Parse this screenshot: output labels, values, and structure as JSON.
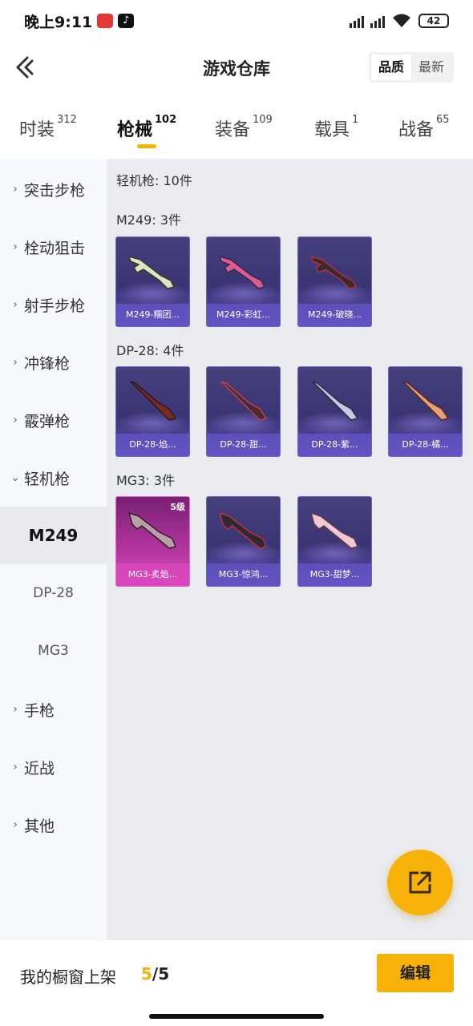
{
  "status": {
    "time": "晚上9:11",
    "battery": "42"
  },
  "header": {
    "title": "游戏仓库",
    "sort_quality": "品质",
    "sort_latest": "最新"
  },
  "tabs": [
    {
      "label": "时装",
      "count": "312"
    },
    {
      "label": "枪械",
      "count": "102"
    },
    {
      "label": "装备",
      "count": "109"
    },
    {
      "label": "载具",
      "count": "1"
    },
    {
      "label": "战备",
      "count": "65"
    }
  ],
  "sidebar": {
    "items": [
      "突击步枪",
      "栓动狙击",
      "射手步枪",
      "冲锋枪",
      "霰弹枪",
      "轻机枪"
    ],
    "subitems": [
      "M249",
      "DP-28",
      "MG3"
    ],
    "after": [
      "手枪",
      "近战",
      "其他"
    ]
  },
  "content": {
    "summary": "轻机枪: 10件",
    "groups": [
      {
        "title": "M249: 3件",
        "items": [
          "M249-糯团...",
          "M249-彩虹...",
          "M249-破晓..."
        ]
      },
      {
        "title": "DP-28: 4件",
        "items": [
          "DP-28-焰...",
          "DP-28-甜...",
          "DP-28-紫...",
          "DP-28-橘..."
        ]
      },
      {
        "title": "MG3: 3件",
        "items": [
          "MG3-炙焰...",
          "MG3-惊鸿...",
          "MG3-甜梦..."
        ],
        "level": "5级"
      }
    ]
  },
  "bottom": {
    "label": "我的橱窗上架",
    "current": "5",
    "sep_total": "/5",
    "edit": "编辑"
  },
  "colors": {
    "accent": "#f7b20a",
    "card_purple": "#46407f",
    "card_pink": "#b4369e"
  }
}
